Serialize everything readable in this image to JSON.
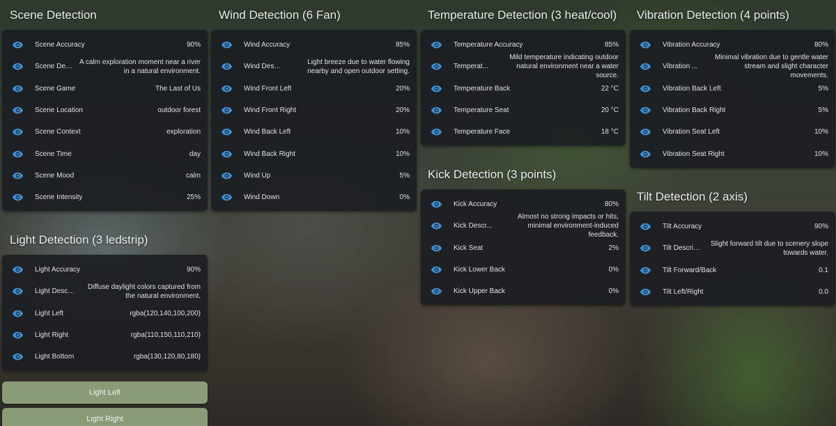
{
  "accent_color": "#3b8fd3",
  "icon": "eye-icon",
  "panels": {
    "scene": {
      "title": "Scene Detection",
      "rows": [
        {
          "label": "Scene Accuracy",
          "value": "90%"
        },
        {
          "label": "Scene Descr...",
          "value": "A calm exploration moment near a river in a natural environment."
        },
        {
          "label": "Scene Game",
          "value": "The Last of Us"
        },
        {
          "label": "Scene Location",
          "value": "outdoor forest"
        },
        {
          "label": "Scene Context",
          "value": "exploration"
        },
        {
          "label": "Scene Time",
          "value": "day"
        },
        {
          "label": "Scene Mood",
          "value": "calm"
        },
        {
          "label": "Scene Intensity",
          "value": "25%"
        }
      ]
    },
    "wind": {
      "title": "Wind Detection (6 Fan)",
      "rows": [
        {
          "label": "Wind Accuracy",
          "value": "85%"
        },
        {
          "label": "Wind Descr...",
          "value": "Light breeze due to water flowing nearby and open outdoor setting."
        },
        {
          "label": "Wind Front Left",
          "value": "20%"
        },
        {
          "label": "Wind Front Right",
          "value": "20%"
        },
        {
          "label": "Wind Back Left",
          "value": "10%"
        },
        {
          "label": "Wind Back Right",
          "value": "10%"
        },
        {
          "label": "Wind Up",
          "value": "5%"
        },
        {
          "label": "Wind Down",
          "value": "0%"
        }
      ]
    },
    "temperature": {
      "title": "Temperature Detection (3 heat/cool)",
      "rows": [
        {
          "label": "Temperature Accuracy",
          "value": "85%"
        },
        {
          "label": "Temperat...",
          "value": "Mild temperature indicating outdoor natural environment near a water source."
        },
        {
          "label": "Temperature Back",
          "value": "22 °C"
        },
        {
          "label": "Temperature Seat",
          "value": "20 °C"
        },
        {
          "label": "Temperature Face",
          "value": "18 °C"
        }
      ]
    },
    "vibration": {
      "title": "Vibration Detection (4 points)",
      "rows": [
        {
          "label": "Vibration Accuracy",
          "value": "80%"
        },
        {
          "label": "Vibration ...",
          "value": "Minimal vibration due to gentle water stream and slight character movements."
        },
        {
          "label": "Vibration Back Left",
          "value": "5%"
        },
        {
          "label": "Vibration Back Right",
          "value": "5%"
        },
        {
          "label": "Vibration Seat Left",
          "value": "10%"
        },
        {
          "label": "Vibration Seat Right",
          "value": "10%"
        }
      ]
    },
    "kick": {
      "title": "Kick Detection (3 points)",
      "rows": [
        {
          "label": "Kick Accuracy",
          "value": "80%"
        },
        {
          "label": "Kick Descr...",
          "value": "Almost no strong impacts or hits, minimal environment-induced feedback."
        },
        {
          "label": "Kick Seat",
          "value": "2%"
        },
        {
          "label": "Kick Lower Back",
          "value": "0%"
        },
        {
          "label": "Kick Upper Back",
          "value": "0%"
        }
      ]
    },
    "tilt": {
      "title": "Tilt Detection (2 axis)",
      "rows": [
        {
          "label": "Tilt Accuracy",
          "value": "90%"
        },
        {
          "label": "Tilt Description",
          "value": "Slight forward tilt due to scenery slope towards water."
        },
        {
          "label": "Tilt Forward/Back",
          "value": "0.1"
        },
        {
          "label": "Tilt Left/Right",
          "value": "0.0"
        }
      ]
    },
    "light": {
      "title": "Light Detection (3 ledstrip)",
      "rows": [
        {
          "label": "Light Accuracy",
          "value": "90%"
        },
        {
          "label": "Light Descri...",
          "value": "Diffuse daylight colors captured from the natural environment."
        },
        {
          "label": "Light Left",
          "value": "rgba(120,140,100,200)"
        },
        {
          "label": "Light Right",
          "value": "rgba(110,150,110,210)"
        },
        {
          "label": "Light Bottom",
          "value": "rgba(130,120,80,180)"
        }
      ]
    }
  },
  "buttons": {
    "light_left": "Light Left",
    "light_right": "Light Right"
  }
}
